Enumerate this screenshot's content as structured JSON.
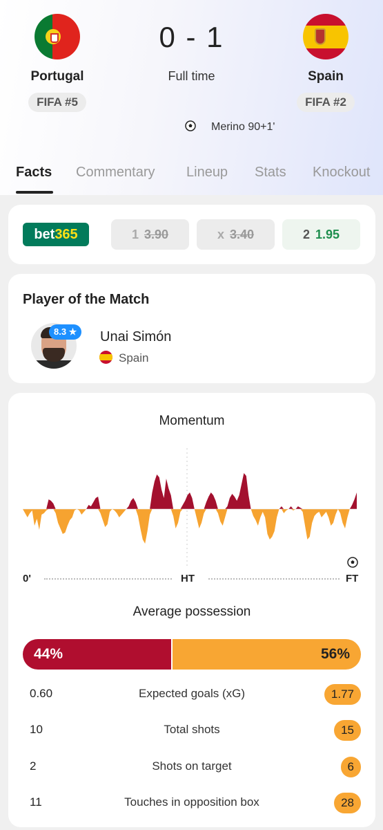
{
  "match": {
    "home": {
      "name": "Portugal",
      "rank": "FIFA #5"
    },
    "away": {
      "name": "Spain",
      "rank": "FIFA #2"
    },
    "score": "0 - 1",
    "status": "Full time",
    "scorer": "Merino 90+1'"
  },
  "tabs": [
    "Facts",
    "Commentary",
    "Lineup",
    "Stats",
    "Knockout"
  ],
  "odds": {
    "bookmaker": {
      "part1": "bet",
      "part2": "365"
    },
    "options": [
      {
        "label": "1",
        "value": "3.90",
        "winner": false
      },
      {
        "label": "x",
        "value": "3.40",
        "winner": false
      },
      {
        "label": "2",
        "value": "1.95",
        "winner": true
      }
    ]
  },
  "player_of_match": {
    "title": "Player of the Match",
    "rating": "8.3 ★",
    "name": "Unai Simón",
    "team": "Spain"
  },
  "momentum": {
    "title": "Momentum",
    "start_label": "0'",
    "half_label": "HT",
    "end_label": "FT",
    "home_color": "#a3102e",
    "away_color": "#f6a330",
    "values": [
      0,
      -3,
      -6,
      -3,
      -1,
      -12,
      -7,
      -15,
      -4,
      -3,
      -1,
      7,
      6,
      4,
      -3,
      -10,
      -14,
      -18,
      -17,
      -12,
      -8,
      -6,
      -1,
      0,
      -1,
      -4,
      -2,
      0,
      3,
      2,
      5,
      8,
      9,
      -3,
      -8,
      -13,
      -11,
      -2,
      0,
      -1,
      -3,
      -6,
      -4,
      -2,
      0,
      2,
      6,
      8,
      5,
      -5,
      -14,
      -22,
      -25,
      -16,
      -4,
      12,
      20,
      25,
      23,
      14,
      8,
      22,
      15,
      10,
      -5,
      -14,
      -10,
      -2,
      3,
      6,
      10,
      12,
      8,
      0,
      -7,
      -14,
      -10,
      -3,
      5,
      9,
      12,
      10,
      6,
      -3,
      -9,
      -12,
      -6,
      2,
      8,
      11,
      9,
      6,
      10,
      18,
      26,
      24,
      10,
      0,
      -5,
      -8,
      -12,
      -6,
      -2,
      -6,
      -18,
      -22,
      -20,
      -16,
      -6,
      0,
      2,
      -3,
      -1,
      0,
      2,
      -1,
      0,
      2,
      1,
      -2,
      -12,
      -22,
      -20,
      -10,
      -5,
      -3,
      -2,
      -6,
      -4,
      -2,
      -6,
      -12,
      -10,
      -4,
      0,
      -3,
      -10,
      -14,
      -6,
      0,
      3,
      7,
      12
    ]
  },
  "possession": {
    "title": "Average possession",
    "home": "44%",
    "away": "56%",
    "home_value": 44,
    "away_value": 56
  },
  "stats": [
    {
      "label": "Expected goals (xG)",
      "home": "0.60",
      "away": "1.77"
    },
    {
      "label": "Total shots",
      "home": "10",
      "away": "15"
    },
    {
      "label": "Shots on target",
      "home": "2",
      "away": "6"
    },
    {
      "label": "Touches in opposition box",
      "home": "11",
      "away": "28"
    }
  ]
}
